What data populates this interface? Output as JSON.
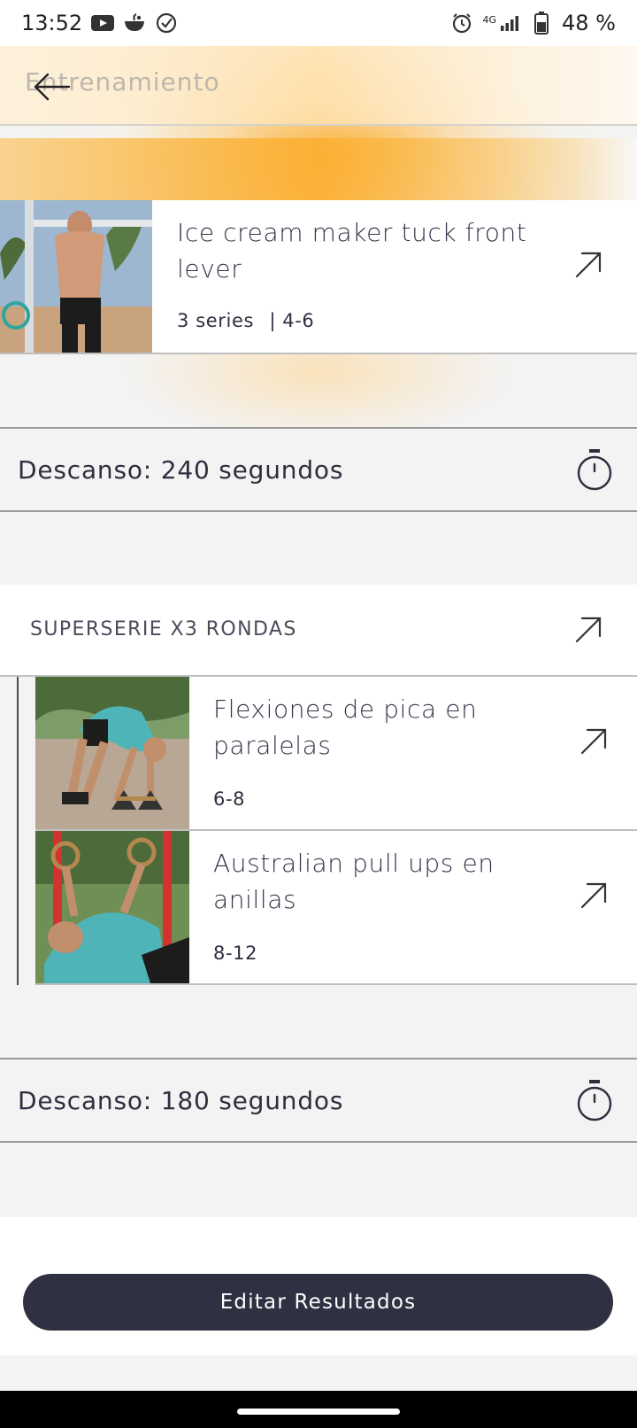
{
  "status_bar": {
    "time": "13:52",
    "network": "4G",
    "battery": "48 %",
    "icons_left": [
      "youtube-icon",
      "bowl-icon",
      "check-circle-icon"
    ],
    "icons_right": [
      "alarm-icon",
      "signal-icon",
      "battery-icon"
    ]
  },
  "header": {
    "title": "Entrenamiento",
    "back_icon": "arrow-left-icon"
  },
  "exercises": {
    "first": {
      "name": "Ice cream maker tuck front lever",
      "series": "3 series",
      "reps": "| 4-6"
    },
    "superset": {
      "label": "SUPERSERIE X3 RONDAS",
      "items": [
        {
          "name": "Flexiones de pica en paralelas",
          "reps": "6-8"
        },
        {
          "name": "Australian pull ups en anillas",
          "reps": "8-12"
        }
      ]
    }
  },
  "rests": [
    {
      "label": "Descanso: 240 segundos"
    },
    {
      "label": "Descanso: 180 segundos"
    }
  ],
  "actions": {
    "edit_results": "Editar Resultados"
  },
  "colors": {
    "accent": "#fbb034",
    "button": "#2f3142",
    "text": "#2d2f3e"
  }
}
